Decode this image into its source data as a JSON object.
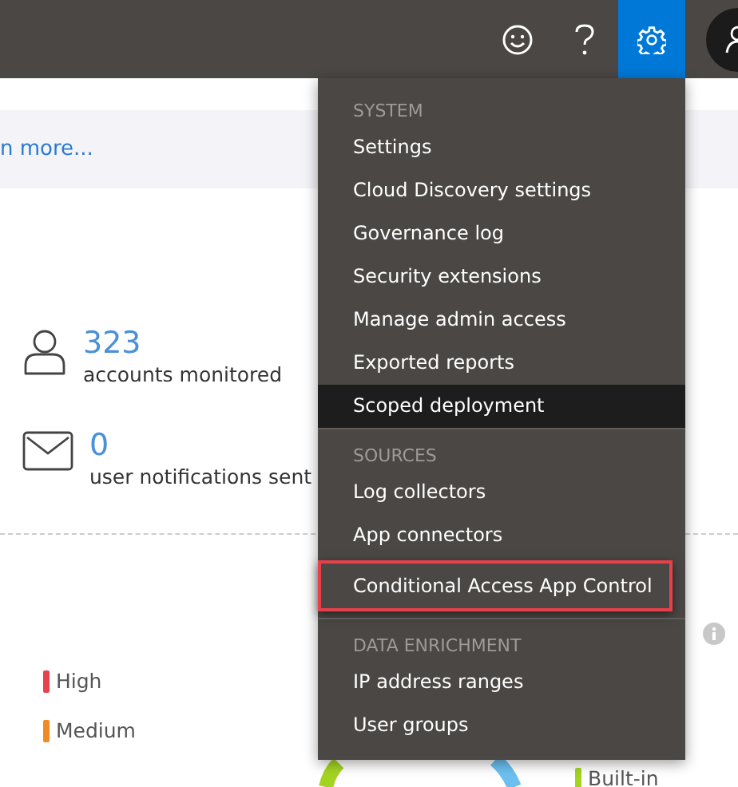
{
  "top_bar": {
    "icons": [
      {
        "kind": "smiley",
        "selected": false
      },
      {
        "kind": "help",
        "selected": false
      },
      {
        "kind": "settings",
        "selected": true
      },
      {
        "kind": "avatar",
        "selected": false
      }
    ]
  },
  "banner": {
    "link": "n more..."
  },
  "stats": [
    {
      "kind": "person",
      "value": "323",
      "label": "accounts monitored"
    },
    {
      "kind": "mail",
      "value": "0",
      "label": "user notifications sent"
    }
  ],
  "legend": [
    {
      "label": "High",
      "color": "#e8414e"
    },
    {
      "label": "Medium",
      "color": "#f08a24"
    },
    {
      "label": "Built-in",
      "color": "#a4d422"
    }
  ],
  "settings_menu": {
    "sections": [
      {
        "header": "SYSTEM",
        "items": [
          {
            "label": "Settings",
            "selected": false,
            "outlined": false
          },
          {
            "label": "Cloud Discovery settings",
            "selected": false,
            "outlined": false
          },
          {
            "label": "Governance log",
            "selected": false,
            "outlined": false
          },
          {
            "label": "Security extensions",
            "selected": false,
            "outlined": false
          },
          {
            "label": "Manage admin access",
            "selected": false,
            "outlined": false
          },
          {
            "label": "Exported reports",
            "selected": false,
            "outlined": false
          },
          {
            "label": "Scoped deployment",
            "selected": true,
            "outlined": false
          }
        ]
      },
      {
        "header": "SOURCES",
        "items": [
          {
            "label": "Log collectors",
            "selected": false,
            "outlined": false
          },
          {
            "label": "App connectors",
            "selected": false,
            "outlined": false
          },
          {
            "label": "Conditional Access App Control",
            "selected": false,
            "outlined": true
          }
        ]
      },
      {
        "header": "DATA ENRICHMENT",
        "items": [
          {
            "label": "IP address ranges",
            "selected": false,
            "outlined": false
          },
          {
            "label": "User groups",
            "selected": false,
            "outlined": false
          }
        ]
      }
    ]
  }
}
